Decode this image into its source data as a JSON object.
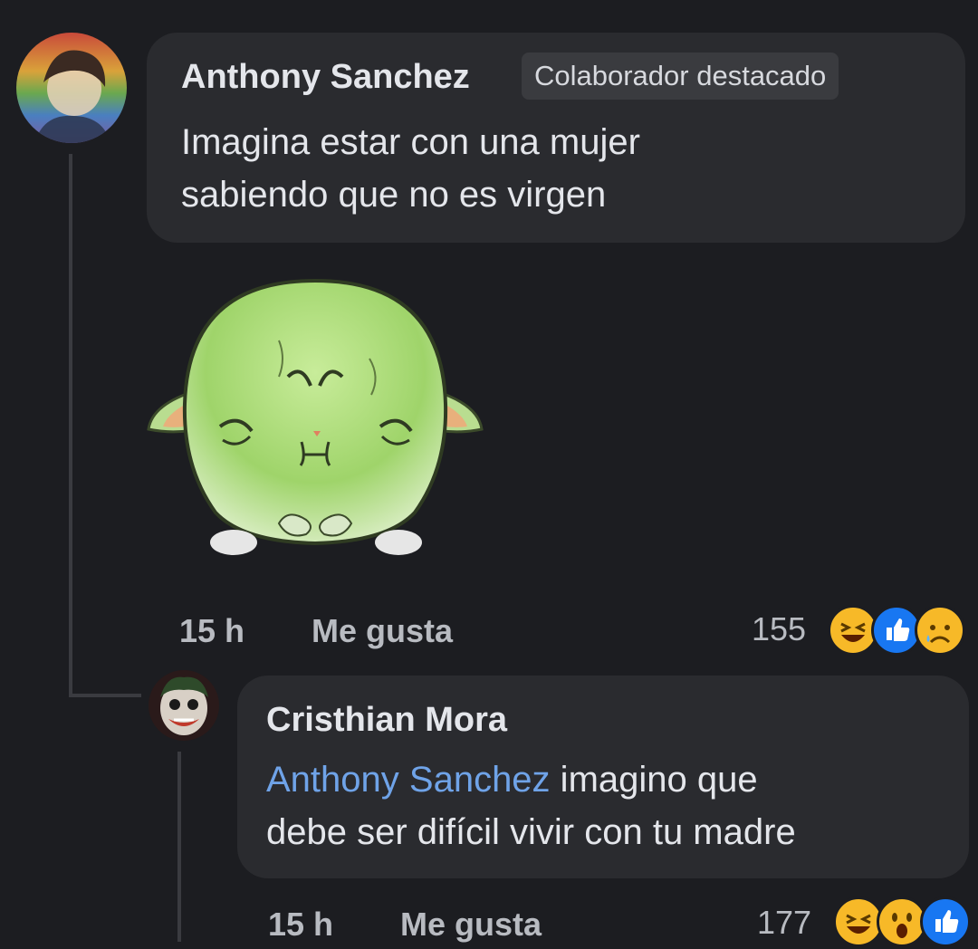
{
  "comments": [
    {
      "author": "Anthony Sanchez",
      "badge": "Colaborador destacado",
      "text_line1": "Imagina estar con una mujer",
      "text_line2": "sabiendo que no es virgen",
      "time": "15 h",
      "like_label": "Me gusta",
      "reaction_count": "155",
      "reactions": [
        "haha-icon",
        "like-icon",
        "sad-icon"
      ]
    },
    {
      "author": "Cristhian Mora",
      "mention": "Anthony Sanchez",
      "text_line1_rest": " imagino que",
      "text_line2": "debe ser difícil vivir con tu madre",
      "time": "15 h",
      "like_label": "Me gusta",
      "reaction_count": "177",
      "reactions": [
        "haha-icon",
        "wow-icon",
        "like-icon"
      ]
    }
  ],
  "colors": {
    "background": "#1c1d21",
    "bubble": "#2a2b2f",
    "mention": "#6fa3e8",
    "like_blue": "#1877f2",
    "haha_yellow": "#f7b928"
  }
}
